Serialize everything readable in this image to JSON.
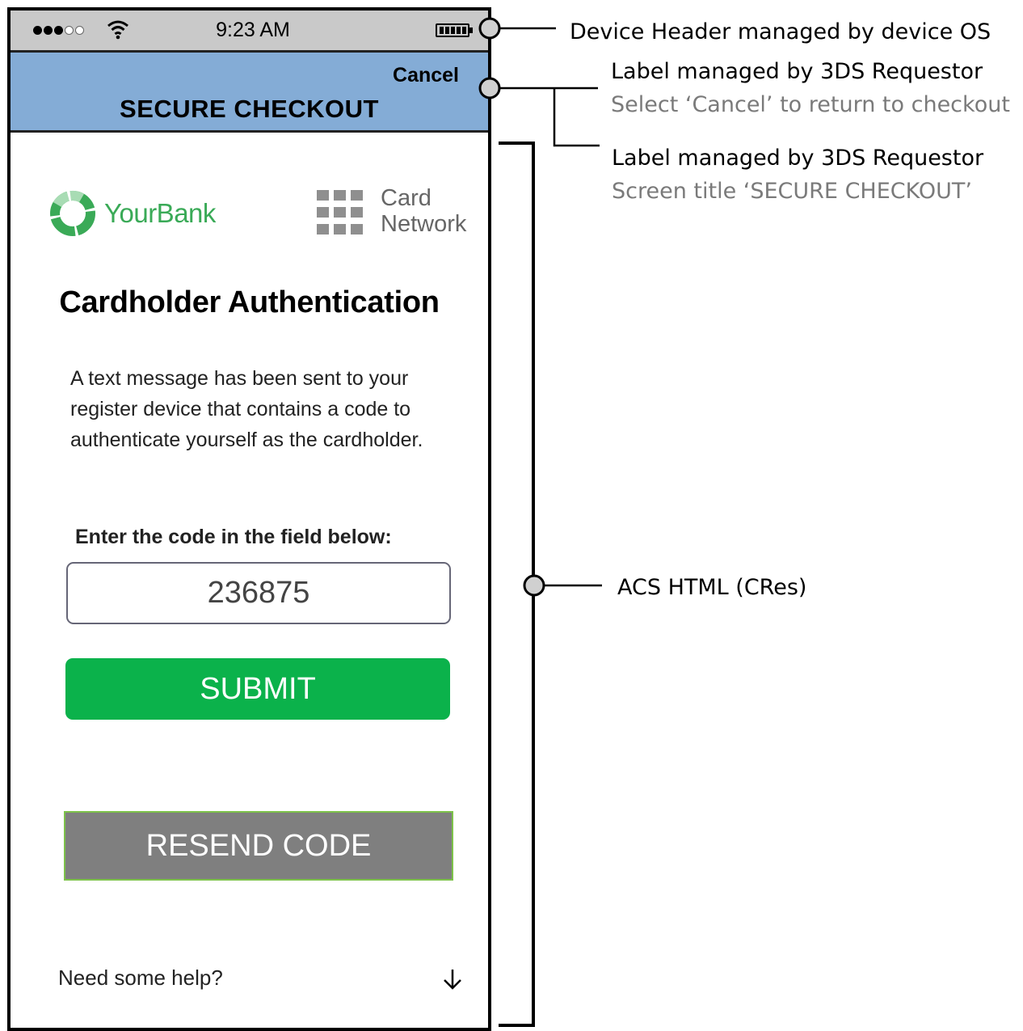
{
  "status_bar": {
    "time": "9:23 AM"
  },
  "header": {
    "cancel_label": "Cancel",
    "title": "SECURE CHECKOUT"
  },
  "branding": {
    "bank_name": "YourBank",
    "network_name_line1": "Card",
    "network_name_line2": "Network"
  },
  "content": {
    "title": "Cardholder Authentication",
    "message": "A text message has been sent to your register device that contains a code to authenticate yourself as the cardholder.",
    "code_label": "Enter the code in the field below:",
    "code_value": "236875",
    "submit_label": "SUBMIT",
    "resend_label": "RESEND CODE",
    "help_label": "Need some help?"
  },
  "annotations": {
    "device_header": "Device Header managed by device OS",
    "cancel_label": {
      "title": "Label managed by 3DS Requestor",
      "subtitle": "Select ‘Cancel’ to return to checkout"
    },
    "screen_title": {
      "title": "Label managed by 3DS Requestor",
      "subtitle": "Screen title ‘SECURE CHECKOUT’"
    },
    "acs_html": "ACS HTML (CRes)"
  },
  "colors": {
    "header_bg": "#84acd6",
    "status_bar_bg": "#c9c9c9",
    "bank_green": "#3aaa57",
    "submit_green": "#0bb24b",
    "resend_gray": "#7f7f7f",
    "resend_border": "#7dc24a"
  },
  "icons": [
    "signal-dots-icon",
    "wifi-icon",
    "battery-icon",
    "yourbank-logo-icon",
    "card-network-grid-icon",
    "arrow-down-icon"
  ]
}
